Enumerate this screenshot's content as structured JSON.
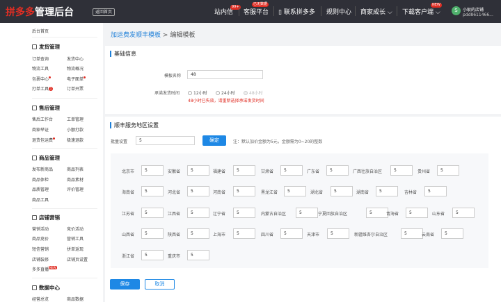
{
  "topbar": {
    "logo_red": "拼多多",
    "logo_white": "管理后台",
    "back_home": "返回首页",
    "nav": {
      "messages": "站内信",
      "messages_badge": "99+",
      "service": "客服平台",
      "service_badge": "已无数据",
      "contact": "联系拼多多",
      "rules": "规则中心",
      "growth": "商家成长",
      "download": "下载客户端",
      "download_badge": "NEW"
    },
    "shop_name": "小耿的店铺",
    "shop_id": "pdd8611466...",
    "avatar_letter": "S"
  },
  "sidebar": {
    "home": "后台首页",
    "sections": [
      {
        "title": "发货管理",
        "items": [
          "订单查询",
          "发货中心",
          "物流工具",
          "物流概况",
          "包裹中心",
          "电子面单",
          "打单工具",
          "订单开票"
        ],
        "tool_badge": "1"
      },
      {
        "title": "售后管理",
        "items": [
          "售后工作台",
          "工单管理",
          "商家举证",
          "小额打款",
          "退货包运费",
          "极速退款"
        ]
      },
      {
        "title": "商品管理",
        "items": [
          "发布新商品",
          "商品列表",
          "商品体检",
          "商品素材",
          "品质管理",
          "评价管理",
          "商品工具"
        ]
      },
      {
        "title": "店铺营销",
        "items": [
          "营销活动",
          "竞价活动",
          "商品竞价",
          "营销工具",
          "短信营销",
          "拼单返现",
          "店铺装修",
          "店铺页设置",
          "多多直播"
        ],
        "live_badge": "NEW"
      },
      {
        "title": "数据中心",
        "items": [
          "经营总览",
          "商品数据"
        ]
      }
    ]
  },
  "breadcrumb": {
    "parent": "加运费发顺丰模板",
    "separator": ">",
    "current": "编辑模板"
  },
  "basic": {
    "title": "基础信息",
    "name_label": "模板名称",
    "name_value": "48",
    "time_label": "承诺发货时间",
    "options": [
      "12小时",
      "24小时",
      "48小时"
    ],
    "selected": "48小时",
    "error": "48小时已失效，请重新选择承诺发货时间"
  },
  "area": {
    "title": "顺丰服务地区设置",
    "batch_label": "批量设置",
    "batch_value": "5",
    "confirm": "确定",
    "note": "注：默认加价金额为5元，金额需为0~20的整数",
    "provinces": [
      [
        "北京市",
        "5"
      ],
      [
        "安徽省",
        "5"
      ],
      [
        "福建省",
        "5"
      ],
      [
        "甘肃省",
        "5"
      ],
      [
        "广东省",
        "5"
      ],
      [
        "广西壮族自治区",
        "5"
      ],
      [
        "贵州省",
        "5"
      ],
      [
        "海南省",
        "5"
      ],
      [
        "河北省",
        "5"
      ],
      [
        "河南省",
        "5"
      ],
      [
        "黑龙江省",
        "5"
      ],
      [
        "湖北省",
        "5"
      ],
      [
        "湖南省",
        "5"
      ],
      [
        "吉林省",
        "5"
      ],
      [
        "江苏省",
        "5"
      ],
      [
        "江西省",
        "5"
      ],
      [
        "辽宁省",
        "5"
      ],
      [
        "内蒙古自治区",
        "5"
      ],
      [
        "宁夏回族自治区",
        "5"
      ],
      [
        "青海省",
        "5"
      ],
      [
        "山东省",
        "5"
      ],
      [
        "山西省",
        "5"
      ],
      [
        "陕西省",
        "5"
      ],
      [
        "上海市",
        "5"
      ],
      [
        "四川省",
        "5"
      ],
      [
        "天津市",
        "5"
      ],
      [
        "新疆维吾尔自治区",
        "5"
      ],
      [
        "云南省",
        "5"
      ],
      [
        "浙江省",
        "5"
      ],
      [
        "重庆市",
        "5"
      ]
    ]
  },
  "footer": {
    "save": "保存",
    "cancel": "取消"
  }
}
